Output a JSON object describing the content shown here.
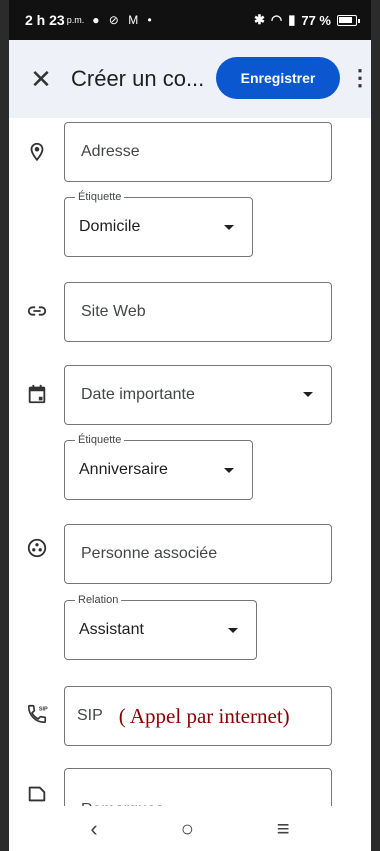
{
  "status_bar": {
    "time": "2 h 23",
    "ampm": "p.m.",
    "notifications": "● ⊘ M •",
    "battery": "77 %"
  },
  "app_bar": {
    "title": "Créer un co...",
    "save_label": "Enregistrer"
  },
  "form": {
    "address_placeholder": "Adresse",
    "address_label_legend": "Étiquette",
    "address_label_value": "Domicile",
    "website_placeholder": "Site Web",
    "date_placeholder": "Date importante",
    "date_label_legend": "Étiquette",
    "date_label_value": "Anniversaire",
    "related_person_placeholder": "Personne associée",
    "relation_legend": "Relation",
    "relation_value": "Assistant",
    "sip_placeholder": "SIP",
    "sip_annotation": "( Appel par internet)",
    "notes_placeholder": "Remarques"
  },
  "nav": {
    "back": "‹",
    "home": "○",
    "recents": "≡"
  },
  "colors": {
    "accent": "#0b57d0",
    "app_bar_bg": "#eef2f8",
    "annotation": "#8b0000"
  }
}
